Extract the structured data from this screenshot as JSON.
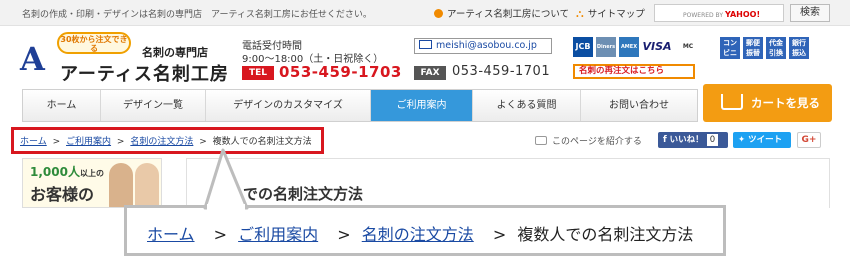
{
  "topbar": {
    "tagline": "名刺の作成・印刷・デザインは名刺の専門店　アーティス名刺工房にお任せください。",
    "about_link": "アーティス名刺工房について",
    "sitemap_link": "サイトマップ",
    "search_powered": "POWERED BY",
    "search_brand": "YAHOO!",
    "search_button": "検索"
  },
  "header": {
    "logo_badge": "30枚から注文できる",
    "logo_sub": "名刺の専門店",
    "logo_name": "アーティス名刺工房",
    "phone_label": "電話受付時間",
    "phone_hours": "9:00〜18:00（土・日祝除く）",
    "tel_tag": "TEL",
    "tel_number": "053-459-1703",
    "email": "meishi@asobou.co.jp",
    "fax_tag": "FAX",
    "fax_number": "053-459-1701",
    "cards": [
      "JCB",
      "Diners",
      "AMEX",
      "VISA",
      "MC"
    ],
    "payments": [
      "コンビニ",
      "郵便振替",
      "代金引換",
      "銀行振込"
    ],
    "reorder": "名刺の再注文はこちら"
  },
  "nav": {
    "items": [
      "ホーム",
      "デザイン一覧",
      "デザインのカスタマイズ",
      "ご利用案内",
      "よくある質問",
      "お問い合わせ"
    ],
    "active_index": 3,
    "cart": "カートを見る"
  },
  "breadcrumb": {
    "home": "ホーム",
    "guide": "ご利用案内",
    "order": "名刺の注文方法",
    "current": "複数人での名刺注文方法",
    "separator": ">"
  },
  "share": {
    "intro": "このページを紹介する",
    "like": "いいね！",
    "like_count": "0",
    "tweet": "ツイート",
    "gplus": "G+"
  },
  "side_banner": {
    "count": "1,000人",
    "count_suffix": "以上の",
    "text": "お客様の"
  },
  "content": {
    "title_fragment": "人での名刺注文方法"
  },
  "colors": {
    "accent": "#3598db",
    "cta": "#f39c12",
    "highlight": "#d8171f",
    "link": "#1a4aa3"
  }
}
